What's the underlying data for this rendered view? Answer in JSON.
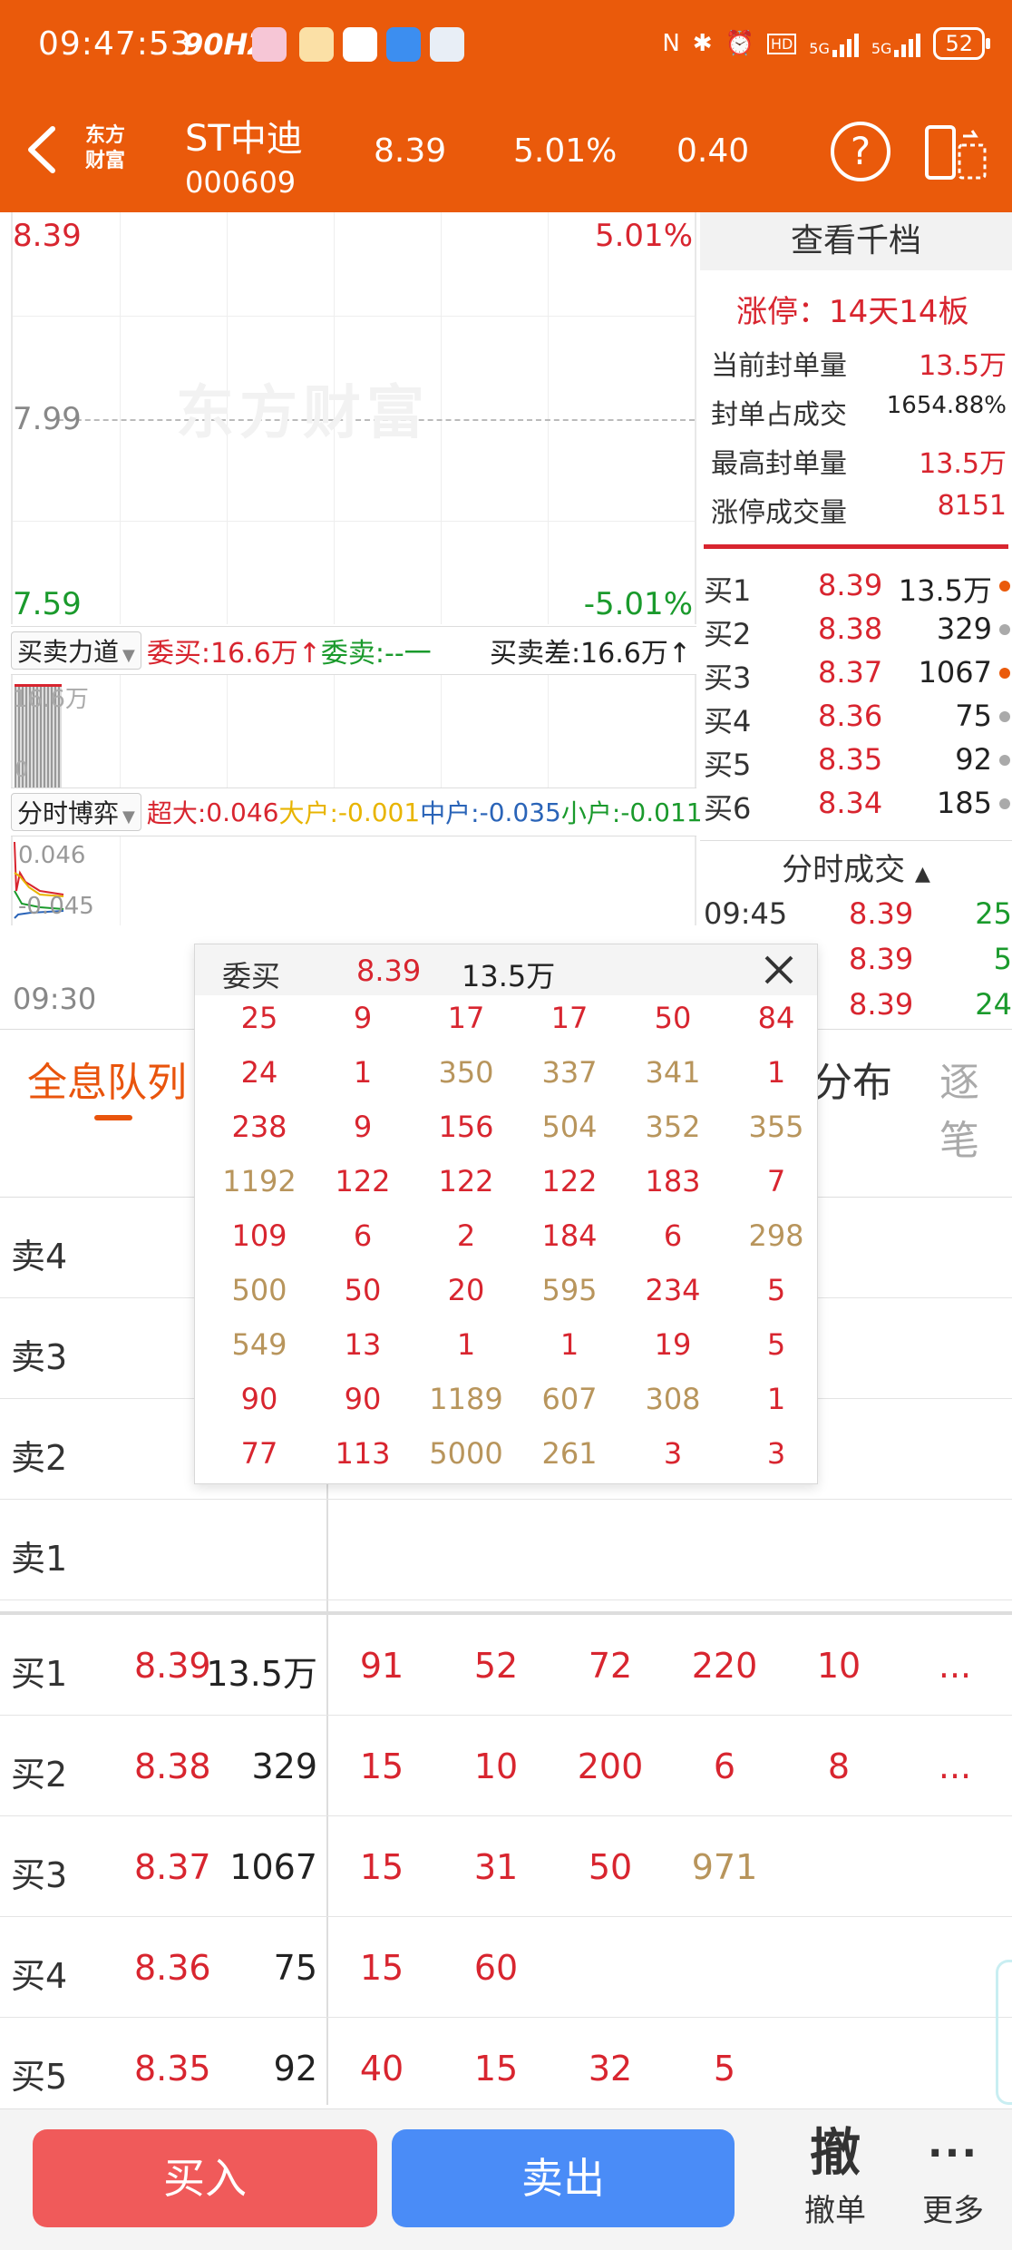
{
  "status_bar": {
    "time": "09:47:53",
    "hz": "90HZ",
    "battery": "52",
    "net1": "5G",
    "net2": "5G"
  },
  "header": {
    "logo": "东方\n财富",
    "stock_name": "ST中迪",
    "stock_code": "000609",
    "price": "8.39",
    "change_pct": "5.01%",
    "change": "0.40"
  },
  "price_chart": {
    "high": "8.39",
    "high_pct": "5.01%",
    "mid": "7.99",
    "low": "7.59",
    "low_pct": "-5.01%",
    "watermark": "东方财富"
  },
  "force": {
    "selector": "买卖力道",
    "buy_label": "委买:",
    "buy_value": "16.6万↑",
    "sell_label": "委卖:",
    "sell_value": "--一",
    "diff": "买卖差:16.6万↑",
    "max": "16.6万",
    "zero": "0"
  },
  "game": {
    "selector": "分时博弈",
    "super_label": "超大:",
    "super": "0.046",
    "large_label": "大户:",
    "large": "-0.001",
    "mid_label": "中户:",
    "mid": "-0.035",
    "small_label": "小户:",
    "small": "-0.011",
    "max": "0.046",
    "min": "-0.045"
  },
  "time_start": "09:30",
  "right_panel": {
    "view_thousand": "查看千档",
    "limit_title": "涨停：14天14板",
    "limit_rows": [
      {
        "label": "当前封单量",
        "value": "13.5万"
      },
      {
        "label": "封单占成交",
        "value": "1654.88%"
      },
      {
        "label": "最高封单量",
        "value": "13.5万"
      },
      {
        "label": "涨停成交量",
        "value": "8151"
      }
    ],
    "bids": [
      {
        "label": "买1",
        "price": "8.39",
        "vol": "13.5万",
        "dot": "#ea5a0b"
      },
      {
        "label": "买2",
        "price": "8.38",
        "vol": "329",
        "dot": "#aaaaaa"
      },
      {
        "label": "买3",
        "price": "8.37",
        "vol": "1067",
        "dot": "#ea5a0b"
      },
      {
        "label": "买4",
        "price": "8.36",
        "vol": "75",
        "dot": "#aaaaaa"
      },
      {
        "label": "买5",
        "price": "8.35",
        "vol": "92",
        "dot": "#aaaaaa"
      },
      {
        "label": "买6",
        "price": "8.34",
        "vol": "185",
        "dot": "#aaaaaa"
      }
    ],
    "ticks_header": "分时成交",
    "ticks": [
      {
        "time": "09:45",
        "price": "8.39",
        "qty": "25"
      },
      {
        "time": "",
        "price": "8.39",
        "qty": "5"
      },
      {
        "time": "",
        "price": "8.39",
        "qty": "24"
      }
    ]
  },
  "tabs": {
    "queue": "全息队列",
    "dist": "分布",
    "tick": "逐笔"
  },
  "queue": {
    "asks": [
      {
        "label": "卖4"
      },
      {
        "label": "卖3"
      },
      {
        "label": "卖2"
      },
      {
        "label": "卖1"
      }
    ],
    "bids": [
      {
        "label": "买1",
        "price": "8.39",
        "vol": "13.5万",
        "orders": [
          "91",
          "52",
          "72",
          "220",
          "10",
          "..."
        ]
      },
      {
        "label": "买2",
        "price": "8.38",
        "vol": "329",
        "orders": [
          "15",
          "10",
          "200",
          "6",
          "8",
          "..."
        ]
      },
      {
        "label": "买3",
        "price": "8.37",
        "vol": "1067",
        "orders": [
          "15",
          "31",
          "50",
          "971"
        ]
      },
      {
        "label": "买4",
        "price": "8.36",
        "vol": "75",
        "orders": [
          "15",
          "60"
        ]
      },
      {
        "label": "买5",
        "price": "8.35",
        "vol": "92",
        "orders": [
          "40",
          "15",
          "32",
          "5"
        ]
      }
    ]
  },
  "popup": {
    "title": "委买",
    "price": "8.39",
    "vol": "13.5万",
    "rows": [
      [
        "25",
        "9",
        "17",
        "17",
        "50",
        "84"
      ],
      [
        "24",
        "1",
        "350",
        "337",
        "341",
        "1"
      ],
      [
        "238",
        "9",
        "156",
        "504",
        "352",
        "355"
      ],
      [
        "1192",
        "122",
        "122",
        "122",
        "183",
        "7"
      ],
      [
        "109",
        "6",
        "2",
        "184",
        "6",
        "298"
      ],
      [
        "500",
        "50",
        "20",
        "595",
        "234",
        "5"
      ],
      [
        "549",
        "13",
        "1",
        "1",
        "19",
        "5"
      ],
      [
        "90",
        "90",
        "1189",
        "607",
        "308",
        "1"
      ],
      [
        "77",
        "113",
        "5000",
        "261",
        "3",
        "3"
      ]
    ]
  },
  "bottom_bar": {
    "buy": "买入",
    "sell": "卖出",
    "cancel_glyph": "撤",
    "cancel": "撤单",
    "more_glyph": "···",
    "more": "更多"
  },
  "colors": {
    "brand": "#ea5a0b",
    "up": "#d8252f",
    "down": "#1a9a2c",
    "gold": "#b8955c"
  }
}
